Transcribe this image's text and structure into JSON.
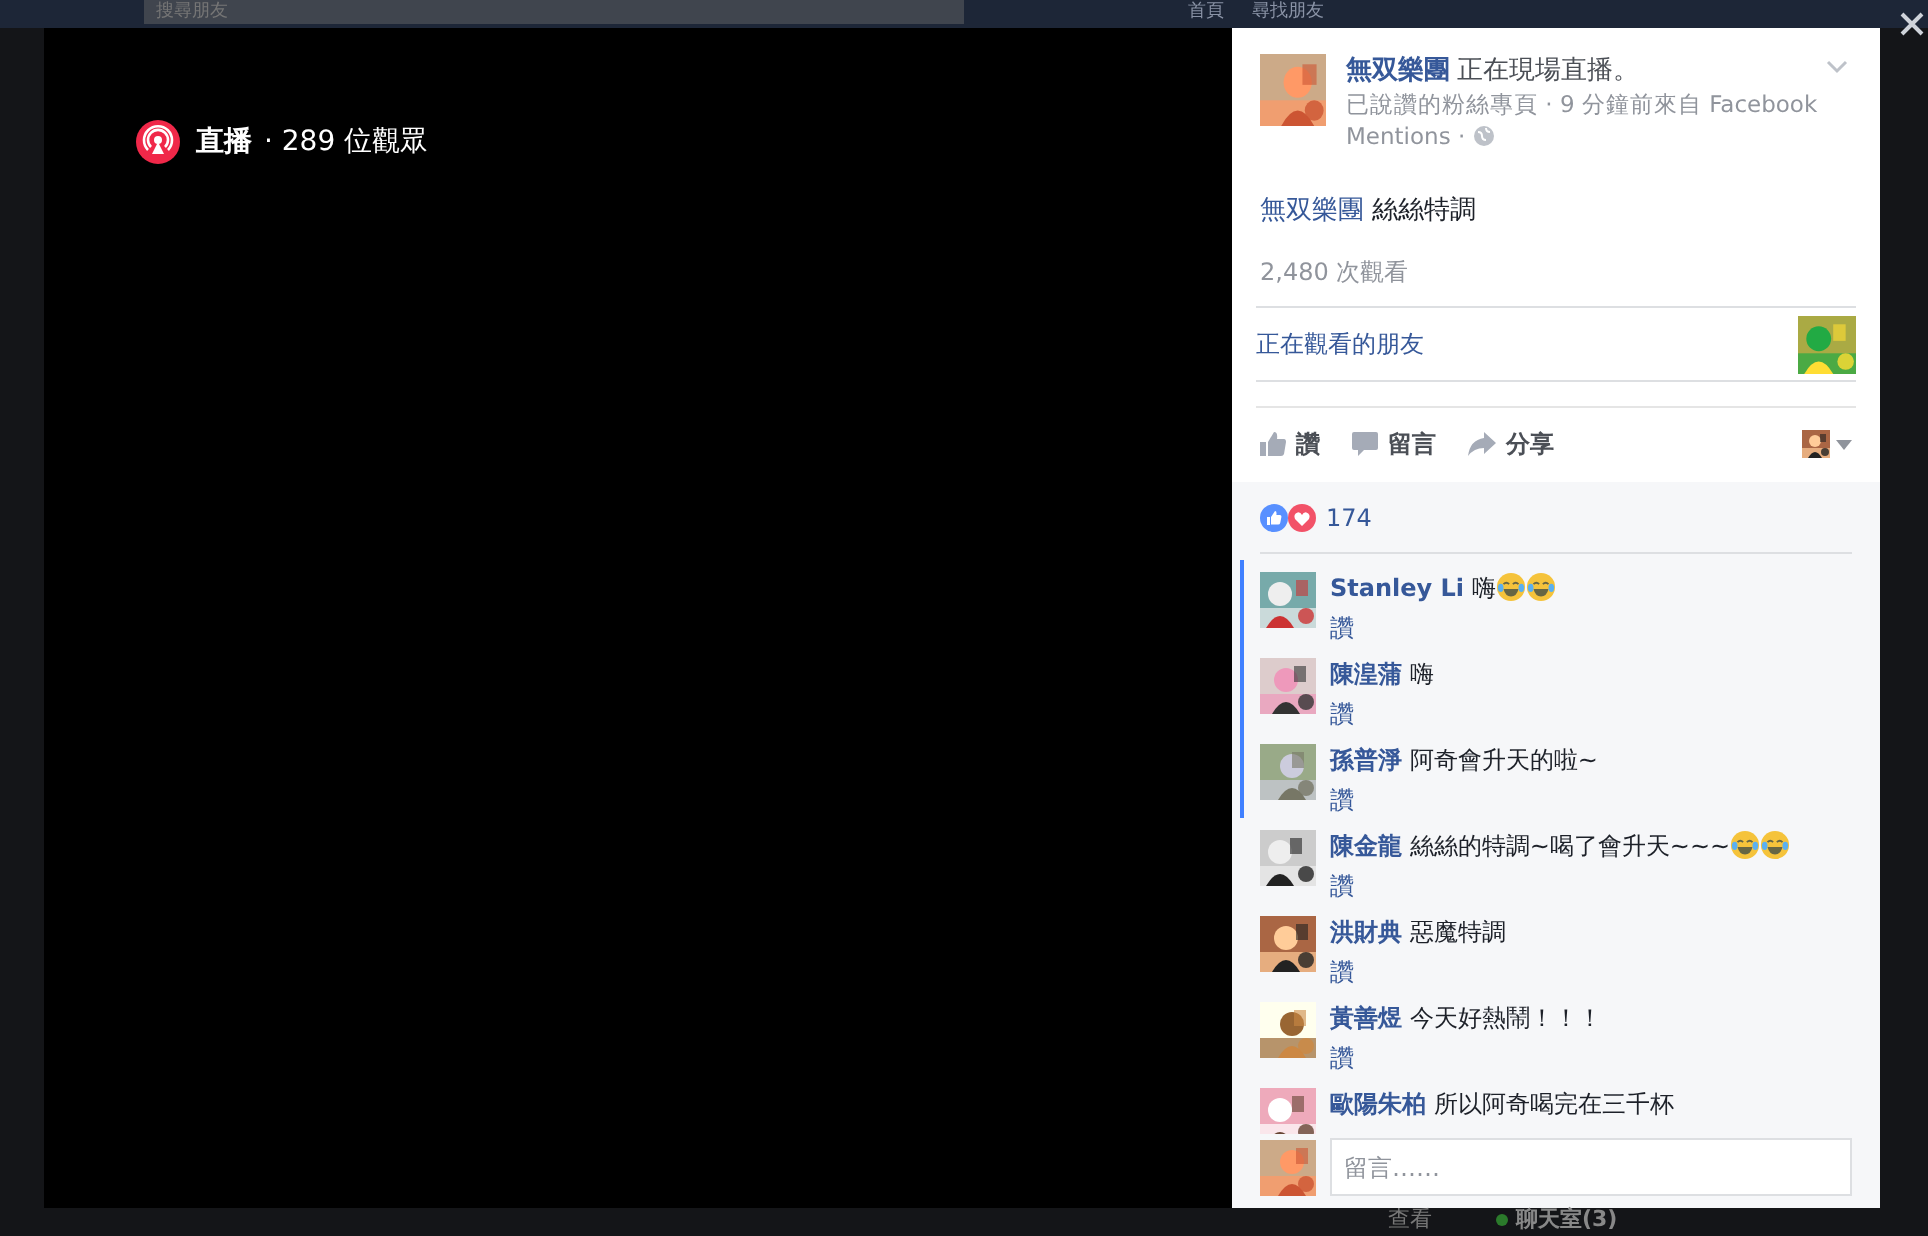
{
  "top_bar": {
    "search": {
      "placeholder": "搜尋朋友"
    },
    "nav": [
      "首頁",
      "尋找朋友"
    ]
  },
  "video": {
    "live_label": "直播",
    "viewers": "· 289 位觀眾"
  },
  "post": {
    "page_name": "無双樂團",
    "headline": "正在現場直播。",
    "meta": [
      "已說讚的粉絲專頁 · 9 分鐘前來自 Facebook",
      "Mentions ·"
    ],
    "text_link": "無双樂團",
    "text": "絲絲特調",
    "views": "2,480 次觀看",
    "watching_friends": "正在觀看的朋友",
    "actions": [
      {
        "kind": "like",
        "label": "讚"
      },
      {
        "kind": "comment",
        "label": "留言"
      },
      {
        "kind": "share",
        "label": "分享"
      }
    ]
  },
  "reactions": {
    "count": "174"
  },
  "comments": [
    {
      "author": "Stanley Li",
      "text": "嗨",
      "emojis": [
        {
          "kind": "tears-of-joy"
        },
        {
          "kind": "tears-of-joy"
        }
      ],
      "like": "讚",
      "highlighted": true
    },
    {
      "author": "陳湟蒲",
      "text": "嗨",
      "like": "讚",
      "highlighted": true
    },
    {
      "author": "孫普淨",
      "text": "阿奇會升天的啦~",
      "like": "讚",
      "highlighted": true
    },
    {
      "author": "陳金龍",
      "text": "絲絲的特調~喝了會升天~~~",
      "emojis": [
        {
          "kind": "tears-of-joy"
        },
        {
          "kind": "tears-of-joy"
        }
      ],
      "like": "讚",
      "highlighted": false
    },
    {
      "author": "洪財典",
      "text": "惡魔特調",
      "like": "讚",
      "highlighted": false
    },
    {
      "author": "黃善煜",
      "text": "今天好熱鬧！！！",
      "like": "讚",
      "highlighted": false
    },
    {
      "author": "歐陽朱柏",
      "text": "所以阿奇喝完在三千杯",
      "highlighted": false
    }
  ],
  "comment_box": {
    "placeholder": "留言……"
  },
  "chat_bar": {
    "see": "查看",
    "chat": "聊天室(3)"
  }
}
